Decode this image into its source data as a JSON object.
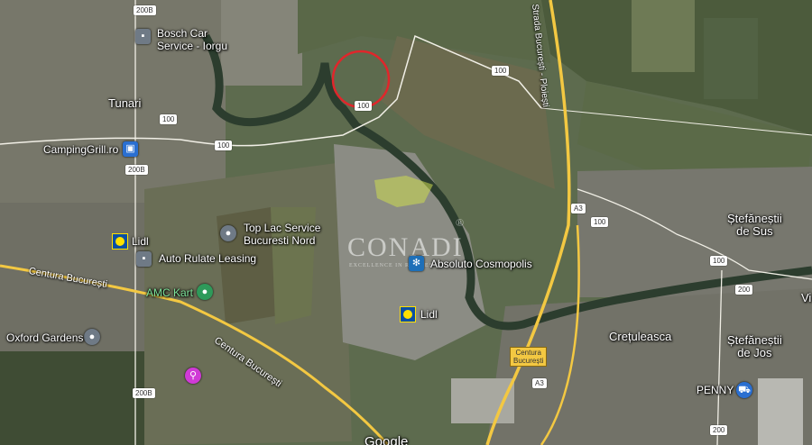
{
  "map": {
    "towns": {
      "tunari": "Tunari",
      "stefanestii_sus": "Ștefăneștii\nde Sus",
      "cretuleasca": "Crețuleasca",
      "stefanestii_jos": "Ștefăneștii\nde Jos",
      "vi_partial": "Vi"
    },
    "pois": {
      "bosch": "Bosch Car\nService - Iorgu",
      "campinggrill": "CampingGrill.ro",
      "top_lac": "Top Lac Service\nBucuresti Nord",
      "lidl_west": "Lidl",
      "auto_rulate": "Auto Rulate Leasing",
      "amc_kart": "AMC Kart",
      "oxford": "Oxford Gardens",
      "absoluto": "Absoluto Cosmopolis",
      "lidl_center": "Lidl",
      "penny": "PENNY"
    },
    "roads": {
      "centura_w": "Centura București",
      "centura_s": "Centura București",
      "a3_name": "Strada București - Ploiești",
      "exit_label": "Centura\nBucurești"
    },
    "shields": [
      "200B",
      "100",
      "100",
      "100",
      "200B",
      "100",
      "100",
      "200",
      "200B",
      "200",
      "A3",
      "A3"
    ],
    "watermark": {
      "brand": "CONADI",
      "tagline": "EXCELLENCE IN REAL ESTATE",
      "registered": "®"
    },
    "google_logo": "Google",
    "colors": {
      "highlight_circle": "#e0262b",
      "highway": "#f3c842",
      "road": "#f1efe6"
    }
  }
}
